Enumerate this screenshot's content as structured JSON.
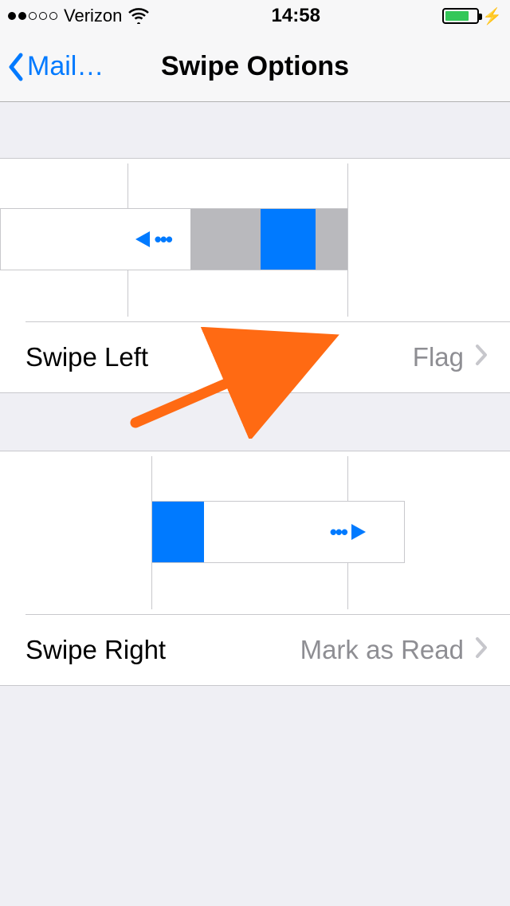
{
  "status": {
    "carrier": "Verizon",
    "time": "14:58"
  },
  "nav": {
    "back_label": "Mail…",
    "title": "Swipe Options"
  },
  "rows": {
    "swipe_left": {
      "label": "Swipe Left",
      "value": "Flag"
    },
    "swipe_right": {
      "label": "Swipe Right",
      "value": "Mark as Read"
    }
  }
}
